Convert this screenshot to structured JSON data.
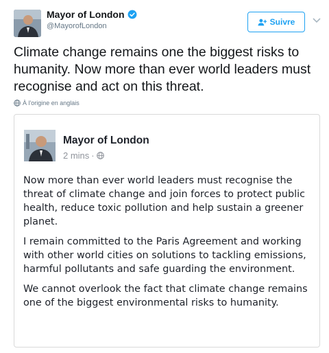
{
  "tweet": {
    "display_name": "Mayor of London",
    "handle": "@MayorofLondon",
    "follow_label": "Suivre",
    "text": "Climate change remains one the biggest risks to humanity. Now more than ever world leaders must recognise and act on this threat.",
    "translation_note": "À l'origine en anglais"
  },
  "embedded_post": {
    "author": "Mayor of London",
    "time": "2 mins",
    "separator": "·",
    "paragraphs": [
      "Now more than ever world leaders must recognise the threat of climate change and join forces to protect public health, reduce toxic pollution and help sustain a greener planet.",
      "I remain committed to the Paris Agreement and working with other world cities on solutions to tackling emissions, harmful pollutants and safe guarding the environment.",
      "We cannot overlook the fact that climate change remains one of the biggest environmental risks to humanity."
    ]
  },
  "icons": {
    "verified": "verified-badge-icon",
    "follow": "add-user-icon",
    "more": "chevron-down-icon",
    "translate": "globe-icon",
    "audience": "globe-icon"
  },
  "colors": {
    "accent": "#1da1f2",
    "secondary_text": "#657786",
    "card_border": "#d9d9d9"
  }
}
